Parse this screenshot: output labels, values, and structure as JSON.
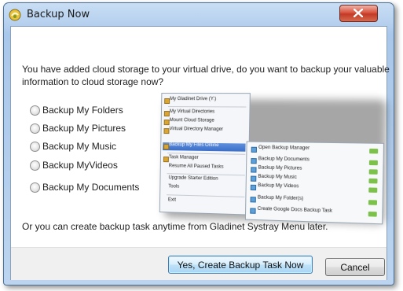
{
  "window": {
    "title": "Backup Now"
  },
  "message": {
    "line1": "You have added cloud storage to your virtual drive, do you want to backup your valuable",
    "line2": "information to cloud storage now?"
  },
  "options": [
    {
      "label": "Backup My Folders"
    },
    {
      "label": "Backup My Pictures"
    },
    {
      "label": "Backup My Music"
    },
    {
      "label": "Backup MyVideos"
    },
    {
      "label": "Backup My Documents"
    }
  ],
  "preview": {
    "menu_items": [
      "My Gladinet Drive (Y:)",
      "My Virtual Directories",
      "Mount Cloud Storage",
      "Virtual Directory Manager",
      "Backup My Files Online",
      "Task Manager",
      "Resume All Paused Tasks",
      "Upgrade Starter Edition",
      "Tools",
      "Exit"
    ],
    "submenu_items": [
      "Open Backup Manager",
      "Backup My Documents",
      "Backup My Pictures",
      "Backup My Music",
      "Backup My Videos",
      "Backup My Folder(s)",
      "Create Google Docs Backup Task"
    ]
  },
  "footer_note": "Or you can create backup task anytime from Gladinet Systray Menu later.",
  "buttons": {
    "primary": "Yes, Create Backup Task Now",
    "cancel": "Cancel"
  },
  "colors": {
    "accent": "#3c7fb1",
    "close": "#c33a25"
  }
}
